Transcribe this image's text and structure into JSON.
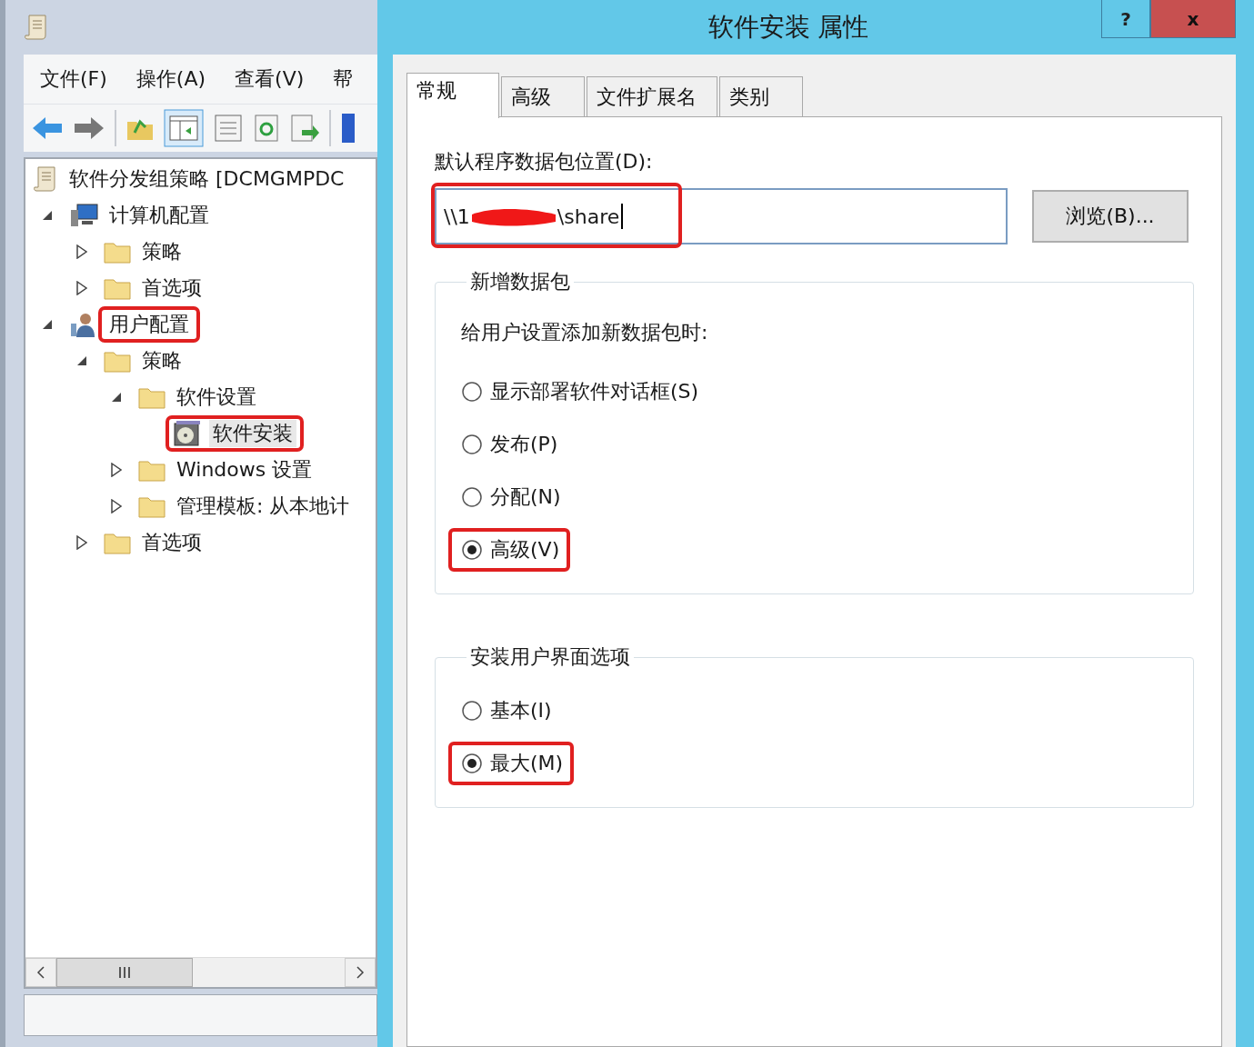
{
  "main_window": {
    "menu": [
      "文件(F)",
      "操作(A)",
      "查看(V)",
      "帮"
    ],
    "tree": [
      {
        "label": "软件分发组策略 [DCMGMPDC",
        "kind": "policy",
        "children": [
          {
            "label": "计算机配置",
            "kind": "computer",
            "expanded": true,
            "highlighted": false,
            "children": [
              {
                "label": "策略",
                "kind": "folder",
                "expanded": false,
                "highlighted": false
              },
              {
                "label": "首选项",
                "kind": "folder",
                "expanded": false,
                "highlighted": false
              }
            ]
          },
          {
            "label": "用户配置",
            "kind": "user",
            "expanded": true,
            "highlighted": true,
            "children": [
              {
                "label": "策略",
                "kind": "folder",
                "expanded": true,
                "highlighted": false,
                "children": [
                  {
                    "label": "软件设置",
                    "kind": "folder",
                    "expanded": true,
                    "highlighted": false,
                    "children": [
                      {
                        "label": "软件安装",
                        "kind": "package",
                        "highlighted": true
                      }
                    ]
                  },
                  {
                    "label": "Windows 设置",
                    "kind": "folder",
                    "expanded": false,
                    "highlighted": false
                  },
                  {
                    "label": "管理模板: 从本地计",
                    "kind": "folder",
                    "expanded": false,
                    "highlighted": false
                  }
                ]
              },
              {
                "label": "首选项",
                "kind": "folder",
                "expanded": false,
                "highlighted": false
              }
            ]
          }
        ]
      }
    ]
  },
  "dialog": {
    "title": "软件安装 属性",
    "help_button": "?",
    "close_button": "x",
    "tabs": [
      {
        "label": "常规",
        "selected": true
      },
      {
        "label": "高级",
        "selected": false
      },
      {
        "label": "文件扩展名",
        "selected": false
      },
      {
        "label": "类别",
        "selected": false
      }
    ],
    "location": {
      "label": "默认程序数据包位置(D):",
      "value_start": "\\\\1",
      "value_end": "\\share",
      "redacted": true,
      "highlighted": true
    },
    "browse_button": "浏览(B)...",
    "groups": [
      {
        "title": "新增数据包",
        "prompt": "给用户设置添加新数据包时:",
        "options": [
          {
            "label": "显示部署软件对话框(S)",
            "selected": false,
            "highlighted": false
          },
          {
            "label": "发布(P)",
            "selected": false,
            "highlighted": false
          },
          {
            "label": "分配(N)",
            "selected": false,
            "highlighted": false
          },
          {
            "label": "高级(V)",
            "selected": true,
            "highlighted": true
          }
        ]
      },
      {
        "title": "安装用户界面选项",
        "options": [
          {
            "label": "基本(I)",
            "selected": false,
            "highlighted": false
          },
          {
            "label": "最大(M)",
            "selected": true,
            "highlighted": true
          }
        ]
      }
    ]
  }
}
